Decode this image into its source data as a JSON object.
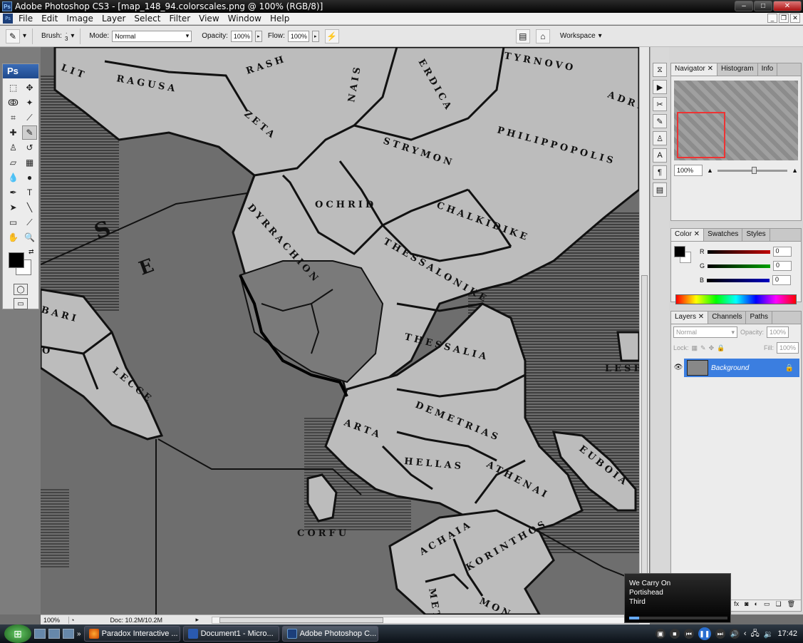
{
  "window": {
    "title": "Adobe Photoshop CS3 - [map_148_94.colorscales.png @ 100% (RGB/8)]",
    "app_icon": "Ps"
  },
  "menu": [
    "File",
    "Edit",
    "Image",
    "Layer",
    "Select",
    "Filter",
    "View",
    "Window",
    "Help"
  ],
  "options": {
    "brush_label": "Brush:",
    "brush_size": "3",
    "mode_label": "Mode:",
    "mode_value": "Normal",
    "opacity_label": "Opacity:",
    "opacity_value": "100%",
    "flow_label": "Flow:",
    "flow_value": "100%",
    "workspace_label": "Workspace"
  },
  "toolbox": {
    "logo": "Ps",
    "tools": [
      "marquee",
      "move",
      "lasso",
      "magic-wand",
      "crop",
      "slice",
      "healing",
      "brush",
      "clone-stamp",
      "history-brush",
      "eraser",
      "gradient",
      "blur",
      "dodge",
      "pen",
      "type",
      "path-select",
      "line",
      "notes",
      "eyedropper",
      "hand",
      "zoom"
    ]
  },
  "map_labels": {
    "ragusa": "RAGUSA",
    "rash": "RASH",
    "nais": "NAIS",
    "serdica": "ERDICA",
    "tyrnovo": "TYRNOVO",
    "adri": "ADRI",
    "zeta": "ZETA",
    "strymon": "STRYMON",
    "philippopolis": "PHILIPPOPOLIS",
    "ochrid": "OCHRID",
    "dyrrachion": "DYRRACHION",
    "chalkidike": "CHALKIDIKE",
    "thessalonike": "THESSALONIKE",
    "thessalia": "THESSALIA",
    "lesbo": "LESBO",
    "demetrias": "DEMETRIAS",
    "arta": "ARTA",
    "hellas": "HELLAS",
    "athenai": "ATHENAI",
    "euboia": "EUBOIA",
    "corfu": "CORFU",
    "achaia": "ACHAIA",
    "korinthos": "KORINTHOS",
    "meth": "METH",
    "mon": "MON",
    "lecce": "LECCE",
    "bari": "BARI",
    "o": "O",
    "lit": "LIT",
    "sea_s": "S",
    "sea_e": "E"
  },
  "status": {
    "zoom": "100%",
    "doc": "Doc: 10.2M/10.2M"
  },
  "navigator": {
    "tabs": [
      "Navigator",
      "Histogram",
      "Info"
    ],
    "zoom": "100%"
  },
  "color_panel": {
    "tabs": [
      "Color",
      "Swatches",
      "Styles"
    ],
    "channels": [
      {
        "label": "R",
        "value": "0",
        "color": "#c00000"
      },
      {
        "label": "G",
        "value": "0",
        "color": "#00a000"
      },
      {
        "label": "B",
        "value": "0",
        "color": "#0000c0"
      }
    ]
  },
  "layers_panel": {
    "tabs": [
      "Layers",
      "Channels",
      "Paths"
    ],
    "blend_mode": "Normal",
    "opacity_label": "Opacity:",
    "opacity_value": "100%",
    "lock_label": "Lock:",
    "fill_label": "Fill:",
    "fill_value": "100%",
    "layer_name": "Background"
  },
  "media_popup": {
    "track": "We Carry On",
    "artist": "Portishead",
    "album": "Third"
  },
  "taskbar": {
    "tasks": [
      "Paradox Interactive ...",
      "Document1 - Micro...",
      "Adobe Photoshop C..."
    ],
    "clock": "17:42"
  }
}
